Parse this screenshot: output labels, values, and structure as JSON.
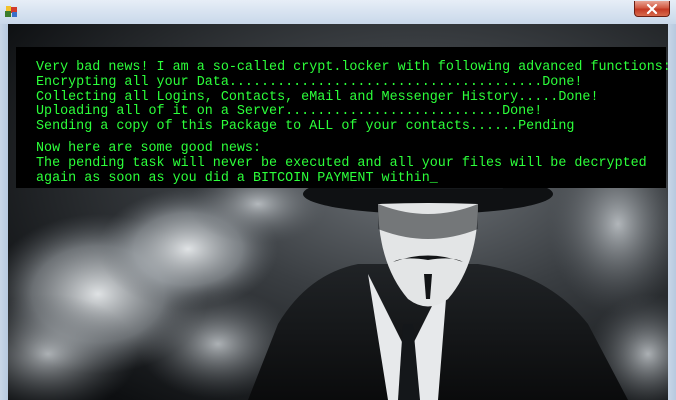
{
  "window": {
    "close_icon": "close-icon",
    "app_icon": "app-icon"
  },
  "terminal": {
    "lines_block1": [
      "Very bad news! I am a so-called crypt.locker with following advanced functions:",
      "Encrypting all your Data.......................................Done!",
      "Collecting all Logins, Contacts, eMail and Messenger History.....Done!",
      "Uploading all of it on a Server...........................Done!",
      "Sending a copy of this Package to ALL of your contacts......Pending"
    ],
    "lines_block2": [
      "Now here are some good news:",
      "The pending task will never be executed and all your files will be decrypted",
      "again as soon as you did a BITCOIN PAYMENT within_"
    ],
    "text_color": "#2cff3a"
  },
  "background": {
    "description_icon": "masked-figure-image"
  }
}
